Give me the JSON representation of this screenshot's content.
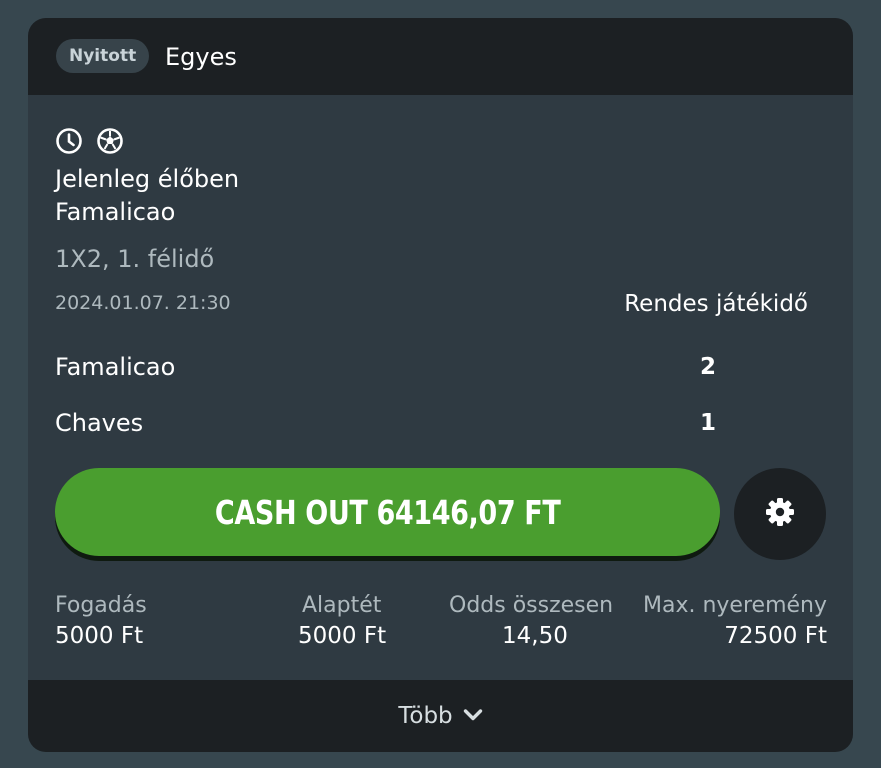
{
  "header": {
    "status_badge": "Nyitott",
    "bet_type": "Egyes"
  },
  "icons": [
    "clock-icon",
    "soccer-ball-icon"
  ],
  "event": {
    "live_status": "Jelenleg élőben",
    "name": "Famalicao",
    "market": "1X2, 1. félidő",
    "datetime": "2024.01.07.  21:30",
    "period": "Rendes játékidő",
    "teams": [
      {
        "name": "Famalicao",
        "score": "2"
      },
      {
        "name": "Chaves",
        "score": "1"
      }
    ]
  },
  "cashout": {
    "label": "CASH OUT 64146,07 FT"
  },
  "stats": {
    "stake": {
      "label": "Fogadás",
      "value": "5000 Ft"
    },
    "base_stake": {
      "label": "Alaptét",
      "value": "5000 Ft"
    },
    "total_odds": {
      "label": "Odds összesen",
      "value": "14,50"
    },
    "max_win": {
      "label": "Max. nyeremény",
      "value": "72500 Ft"
    }
  },
  "footer": {
    "more_label": "Több"
  },
  "colors": {
    "background": "#37474f",
    "card": "#2f3a42",
    "header": "#1c2023",
    "cashout_green": "#4a9e2f"
  }
}
